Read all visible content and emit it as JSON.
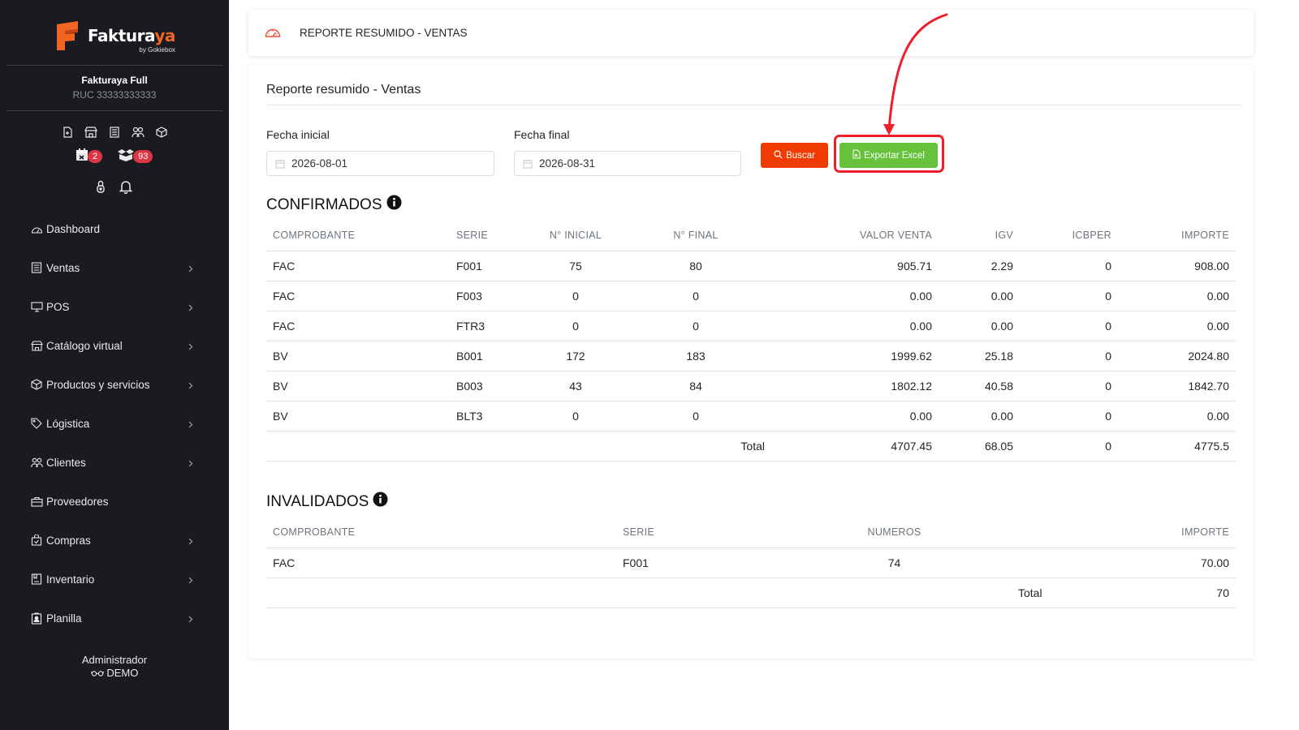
{
  "brand": {
    "name_main": "Faktura",
    "name_accent": "ya",
    "by": "by Gokiebox"
  },
  "company": {
    "name": "Fakturaya Full",
    "ruc": "RUC 33333333333"
  },
  "badges": {
    "calendar_count": "2",
    "boxes_count": "93"
  },
  "nav": {
    "items": [
      {
        "label": "Dashboard",
        "icon": "dashboard-icon",
        "chevron": false
      },
      {
        "label": "Ventas",
        "icon": "receipt-icon",
        "chevron": true
      },
      {
        "label": "POS",
        "icon": "monitor-icon",
        "chevron": true
      },
      {
        "label": "Catálogo virtual",
        "icon": "store-icon",
        "chevron": true
      },
      {
        "label": "Productos y servicios",
        "icon": "box-icon",
        "chevron": true
      },
      {
        "label": "Lógistica",
        "icon": "tag-icon",
        "chevron": true
      },
      {
        "label": "Clientes",
        "icon": "users-icon",
        "chevron": true
      },
      {
        "label": "Proveedores",
        "icon": "briefcase-icon",
        "chevron": false
      },
      {
        "label": "Compras",
        "icon": "bag-icon",
        "chevron": true
      },
      {
        "label": "Inventario",
        "icon": "inventory-icon",
        "chevron": true
      },
      {
        "label": "Planilla",
        "icon": "badge-icon",
        "chevron": true
      }
    ]
  },
  "user": {
    "role": "Administrador",
    "name": "DEMO"
  },
  "header": {
    "title": "REPORTE RESUMIDO - VENTAS"
  },
  "card": {
    "title": "Reporte resumido - Ventas"
  },
  "filters": {
    "start_label": "Fecha inicial",
    "start_value": "2026-08-01",
    "end_label": "Fecha final",
    "end_value": "2026-08-31",
    "search_button": "Buscar",
    "export_button": "Exportar Excel"
  },
  "confirmados": {
    "title": "CONFIRMADOS",
    "columns": [
      "COMPROBANTE",
      "SERIE",
      "N° INICIAL",
      "N° FINAL",
      "VALOR VENTA",
      "IGV",
      "ICBPER",
      "IMPORTE"
    ],
    "rows": [
      [
        "FAC",
        "F001",
        "75",
        "80",
        "905.71",
        "2.29",
        "0",
        "908.00"
      ],
      [
        "FAC",
        "F003",
        "0",
        "0",
        "0.00",
        "0.00",
        "0",
        "0.00"
      ],
      [
        "FAC",
        "FTR3",
        "0",
        "0",
        "0.00",
        "0.00",
        "0",
        "0.00"
      ],
      [
        "BV",
        "B001",
        "172",
        "183",
        "1999.62",
        "25.18",
        "0",
        "2024.80"
      ],
      [
        "BV",
        "B003",
        "43",
        "84",
        "1802.12",
        "40.58",
        "0",
        "1842.70"
      ],
      [
        "BV",
        "BLT3",
        "0",
        "0",
        "0.00",
        "0.00",
        "0",
        "0.00"
      ]
    ],
    "total": {
      "label": "Total",
      "valor_venta": "4707.45",
      "igv": "68.05",
      "icbper": "0",
      "importe": "4775.5"
    }
  },
  "invalidados": {
    "title": "INVALIDADOS",
    "columns": [
      "COMPROBANTE",
      "SERIE",
      "NUMEROS",
      "IMPORTE"
    ],
    "rows": [
      [
        "FAC",
        "F001",
        "74",
        "70.00"
      ]
    ],
    "total": {
      "label": "Total",
      "importe": "70"
    }
  },
  "colors": {
    "sidebar_bg": "#191b20",
    "brand_orange": "#f26522",
    "search_button": "#f03c02",
    "export_button": "#65c23a",
    "highlight_red": "#ee1f2a",
    "badge_red": "#dc3545"
  }
}
